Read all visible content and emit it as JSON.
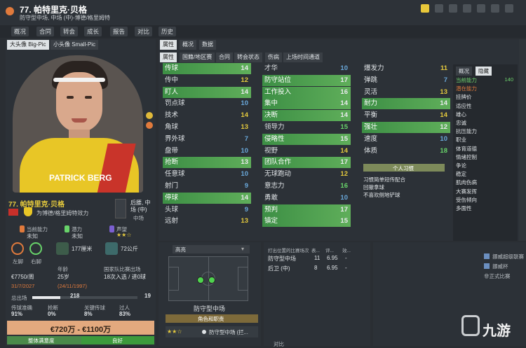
{
  "header": {
    "title": "77. 帕特里克·贝格",
    "subtitle": "防守型中场, 中场 (中)-博德/格里姆特"
  },
  "nav": {
    "items": [
      "概况",
      "合同",
      "转会",
      "成长",
      "报告",
      "对比",
      "历史"
    ]
  },
  "left": {
    "tabs": [
      "大头像 Big-Pic",
      "小头像 Small-Pic"
    ],
    "portrait_sponsor": "PATRICK BERG",
    "name": "77. 帕特里克·贝格",
    "club_line": "为博德/格里姆特效力",
    "positions": "后腰, 中场 (中)",
    "position_short": "中场",
    "current_ability_label": "当前能力",
    "current_ability_value": "未知",
    "potential_label": "潜力",
    "potential_value": "未知",
    "reputation_label": "声望",
    "left_foot_label": "左脚",
    "right_foot_label": "右脚",
    "height": "177厘米",
    "weight": "72公斤",
    "wage": "€7750/周",
    "age_label": "年龄",
    "age": "25岁",
    "national_label": "国家队比赛出场",
    "national": "18次入选 / 进0球",
    "contract_end": "31/7/2027",
    "birth": "(24/11/1997)",
    "stat_label": "总出场",
    "stat_value_left": "218",
    "stat_value_right": "19",
    "pct1_label": "传球准确",
    "pct1": "91%",
    "pct2_label": "抢断",
    "pct2": "0%",
    "pct3_label": "关键传球",
    "pct3": "8%",
    "pct4_label": "过人",
    "pct4": "83%",
    "value_range": "€720万 - €1100万",
    "morale_label": "整体满意度",
    "morale_value": "良好"
  },
  "attr_tabs": [
    "属性",
    "概况",
    "数据"
  ],
  "attr_subtabs": [
    "属性",
    "国籍/地区赛",
    "合同",
    "转会状态",
    "伤病",
    "上场时间通道"
  ],
  "tech": [
    {
      "name": "传球",
      "value": "14",
      "hl": true
    },
    {
      "name": "传中",
      "value": "12",
      "hl": false
    },
    {
      "name": "盯人",
      "value": "14",
      "hl": true
    },
    {
      "name": "罚点球",
      "value": "10",
      "hl": false
    },
    {
      "name": "技术",
      "value": "14",
      "hl": false
    },
    {
      "name": "角球",
      "value": "13",
      "hl": false
    },
    {
      "name": "界外球",
      "value": "7",
      "hl": false
    },
    {
      "name": "盘带",
      "value": "10",
      "hl": false
    },
    {
      "name": "抢断",
      "value": "13",
      "hl": true
    },
    {
      "name": "任意球",
      "value": "10",
      "hl": false
    },
    {
      "name": "射门",
      "value": "9",
      "hl": false
    },
    {
      "name": "停球",
      "value": "14",
      "hl": true
    },
    {
      "name": "头球",
      "value": "9",
      "hl": false
    },
    {
      "name": "远射",
      "value": "13",
      "hl": false
    }
  ],
  "mental": [
    {
      "name": "才华",
      "value": "10",
      "hl": false
    },
    {
      "name": "防守站位",
      "value": "17",
      "hl": true
    },
    {
      "name": "工作投入",
      "value": "16",
      "hl": true
    },
    {
      "name": "集中",
      "value": "14",
      "hl": true
    },
    {
      "name": "决断",
      "value": "14",
      "hl": true
    },
    {
      "name": "领导力",
      "value": "15",
      "hl": false
    },
    {
      "name": "侵略性",
      "value": "15",
      "hl": true
    },
    {
      "name": "视野",
      "value": "14",
      "hl": false
    },
    {
      "name": "团队合作",
      "value": "17",
      "hl": true
    },
    {
      "name": "无球跑动",
      "value": "12",
      "hl": false
    },
    {
      "name": "意志力",
      "value": "16",
      "hl": false
    },
    {
      "name": "勇敢",
      "value": "10",
      "hl": false
    },
    {
      "name": "预判",
      "value": "17",
      "hl": true
    },
    {
      "name": "镇定",
      "value": "15",
      "hl": true
    }
  ],
  "physical": [
    {
      "name": "爆发力",
      "value": "11",
      "hl": false
    },
    {
      "name": "弹跳",
      "value": "7",
      "hl": false
    },
    {
      "name": "灵活",
      "value": "13",
      "hl": false
    },
    {
      "name": "耐力",
      "value": "14",
      "hl": true
    },
    {
      "name": "平衡",
      "value": "14",
      "hl": false
    },
    {
      "name": "强壮",
      "value": "12",
      "hl": true
    },
    {
      "name": "速度",
      "value": "10",
      "hl": false
    },
    {
      "name": "体质",
      "value": "18",
      "hl": false
    }
  ],
  "habits": {
    "title": "个人习惯",
    "items": [
      "习惯简单短传配合",
      "回撤拿球",
      "不喜欢侧地铲球"
    ]
  },
  "side": {
    "tabs": [
      "概况",
      "隐藏"
    ],
    "rows": [
      {
        "name": "当前能力",
        "value": "140",
        "color": "#6ed46d"
      },
      {
        "name": "潜在能力",
        "value": "",
        "color": "#e07a3c"
      },
      {
        "name": "挂牌价",
        "value": "",
        "color": ""
      },
      {
        "name": "适应性",
        "value": "",
        "color": ""
      },
      {
        "name": "雄心",
        "value": "",
        "color": ""
      },
      {
        "name": "忠诚",
        "value": "",
        "color": ""
      },
      {
        "name": "抗压能力",
        "value": "",
        "color": ""
      },
      {
        "name": "职业",
        "value": "",
        "color": ""
      },
      {
        "name": "体育道德",
        "value": "",
        "color": ""
      },
      {
        "name": "情绪控制",
        "value": "",
        "color": ""
      },
      {
        "name": "争论",
        "value": "",
        "color": ""
      },
      {
        "name": "稳定",
        "value": "",
        "color": ""
      },
      {
        "name": "肌肉伤病",
        "value": "",
        "color": ""
      },
      {
        "name": "大赛发挥",
        "value": "",
        "color": ""
      },
      {
        "name": "受伤倾向",
        "value": "",
        "color": ""
      },
      {
        "name": "多面性",
        "value": "",
        "color": ""
      }
    ]
  },
  "bottom": {
    "dropdown": "高亮",
    "role_title": "防守型中场",
    "role_duty_btn": "角色和职责",
    "role_row_label": "防守型中场 (拦...",
    "table_header": [
      "打出位置的比赛场次",
      "表...",
      "评...",
      "效..."
    ],
    "table_rows": [
      {
        "pos": "防守型中场",
        "apps": "11",
        "rating": "6.95",
        "extra": "-"
      },
      {
        "pos": "后卫 (中)",
        "apps": "8",
        "rating": "6.95",
        "extra": "-"
      }
    ],
    "compare_label": "对比",
    "right_labels": [
      "挪威超级联赛",
      "挪威杯",
      "非正式比赛"
    ],
    "watermark": "九游"
  },
  "colors": {
    "accent_green": "#5fae5a",
    "value_yellow": "#e4c93d",
    "value_green": "#68d36a",
    "value_blue": "#69a7d9",
    "bg": "#2a2e33"
  }
}
